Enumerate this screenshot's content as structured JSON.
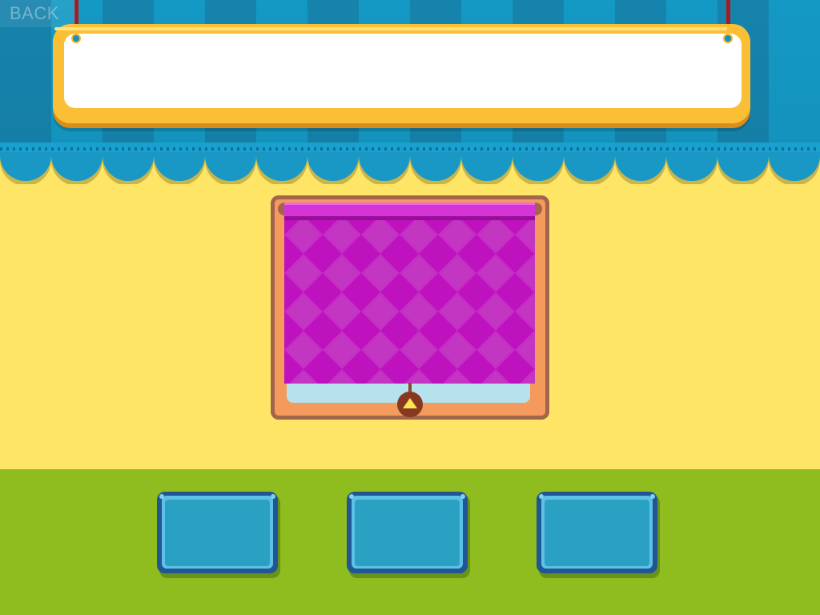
{
  "app": {
    "back_label": "BACK"
  },
  "sign": {
    "text": ""
  },
  "window": {
    "blind_state": "closed",
    "pull_direction_icon": "up-triangle-icon"
  },
  "answers": [
    {
      "label": ""
    },
    {
      "label": ""
    },
    {
      "label": ""
    }
  ],
  "colors": {
    "curtain_dark": "#1686b0",
    "curtain_light": "#149cc8",
    "wall": "#fee566",
    "sign_border": "#fbbf35",
    "blind": "#bd12bd",
    "window_frame": "#f39a5c",
    "grass": "#8fbd20",
    "tile": "#2aa0c2",
    "tile_border": "#1f5693"
  }
}
